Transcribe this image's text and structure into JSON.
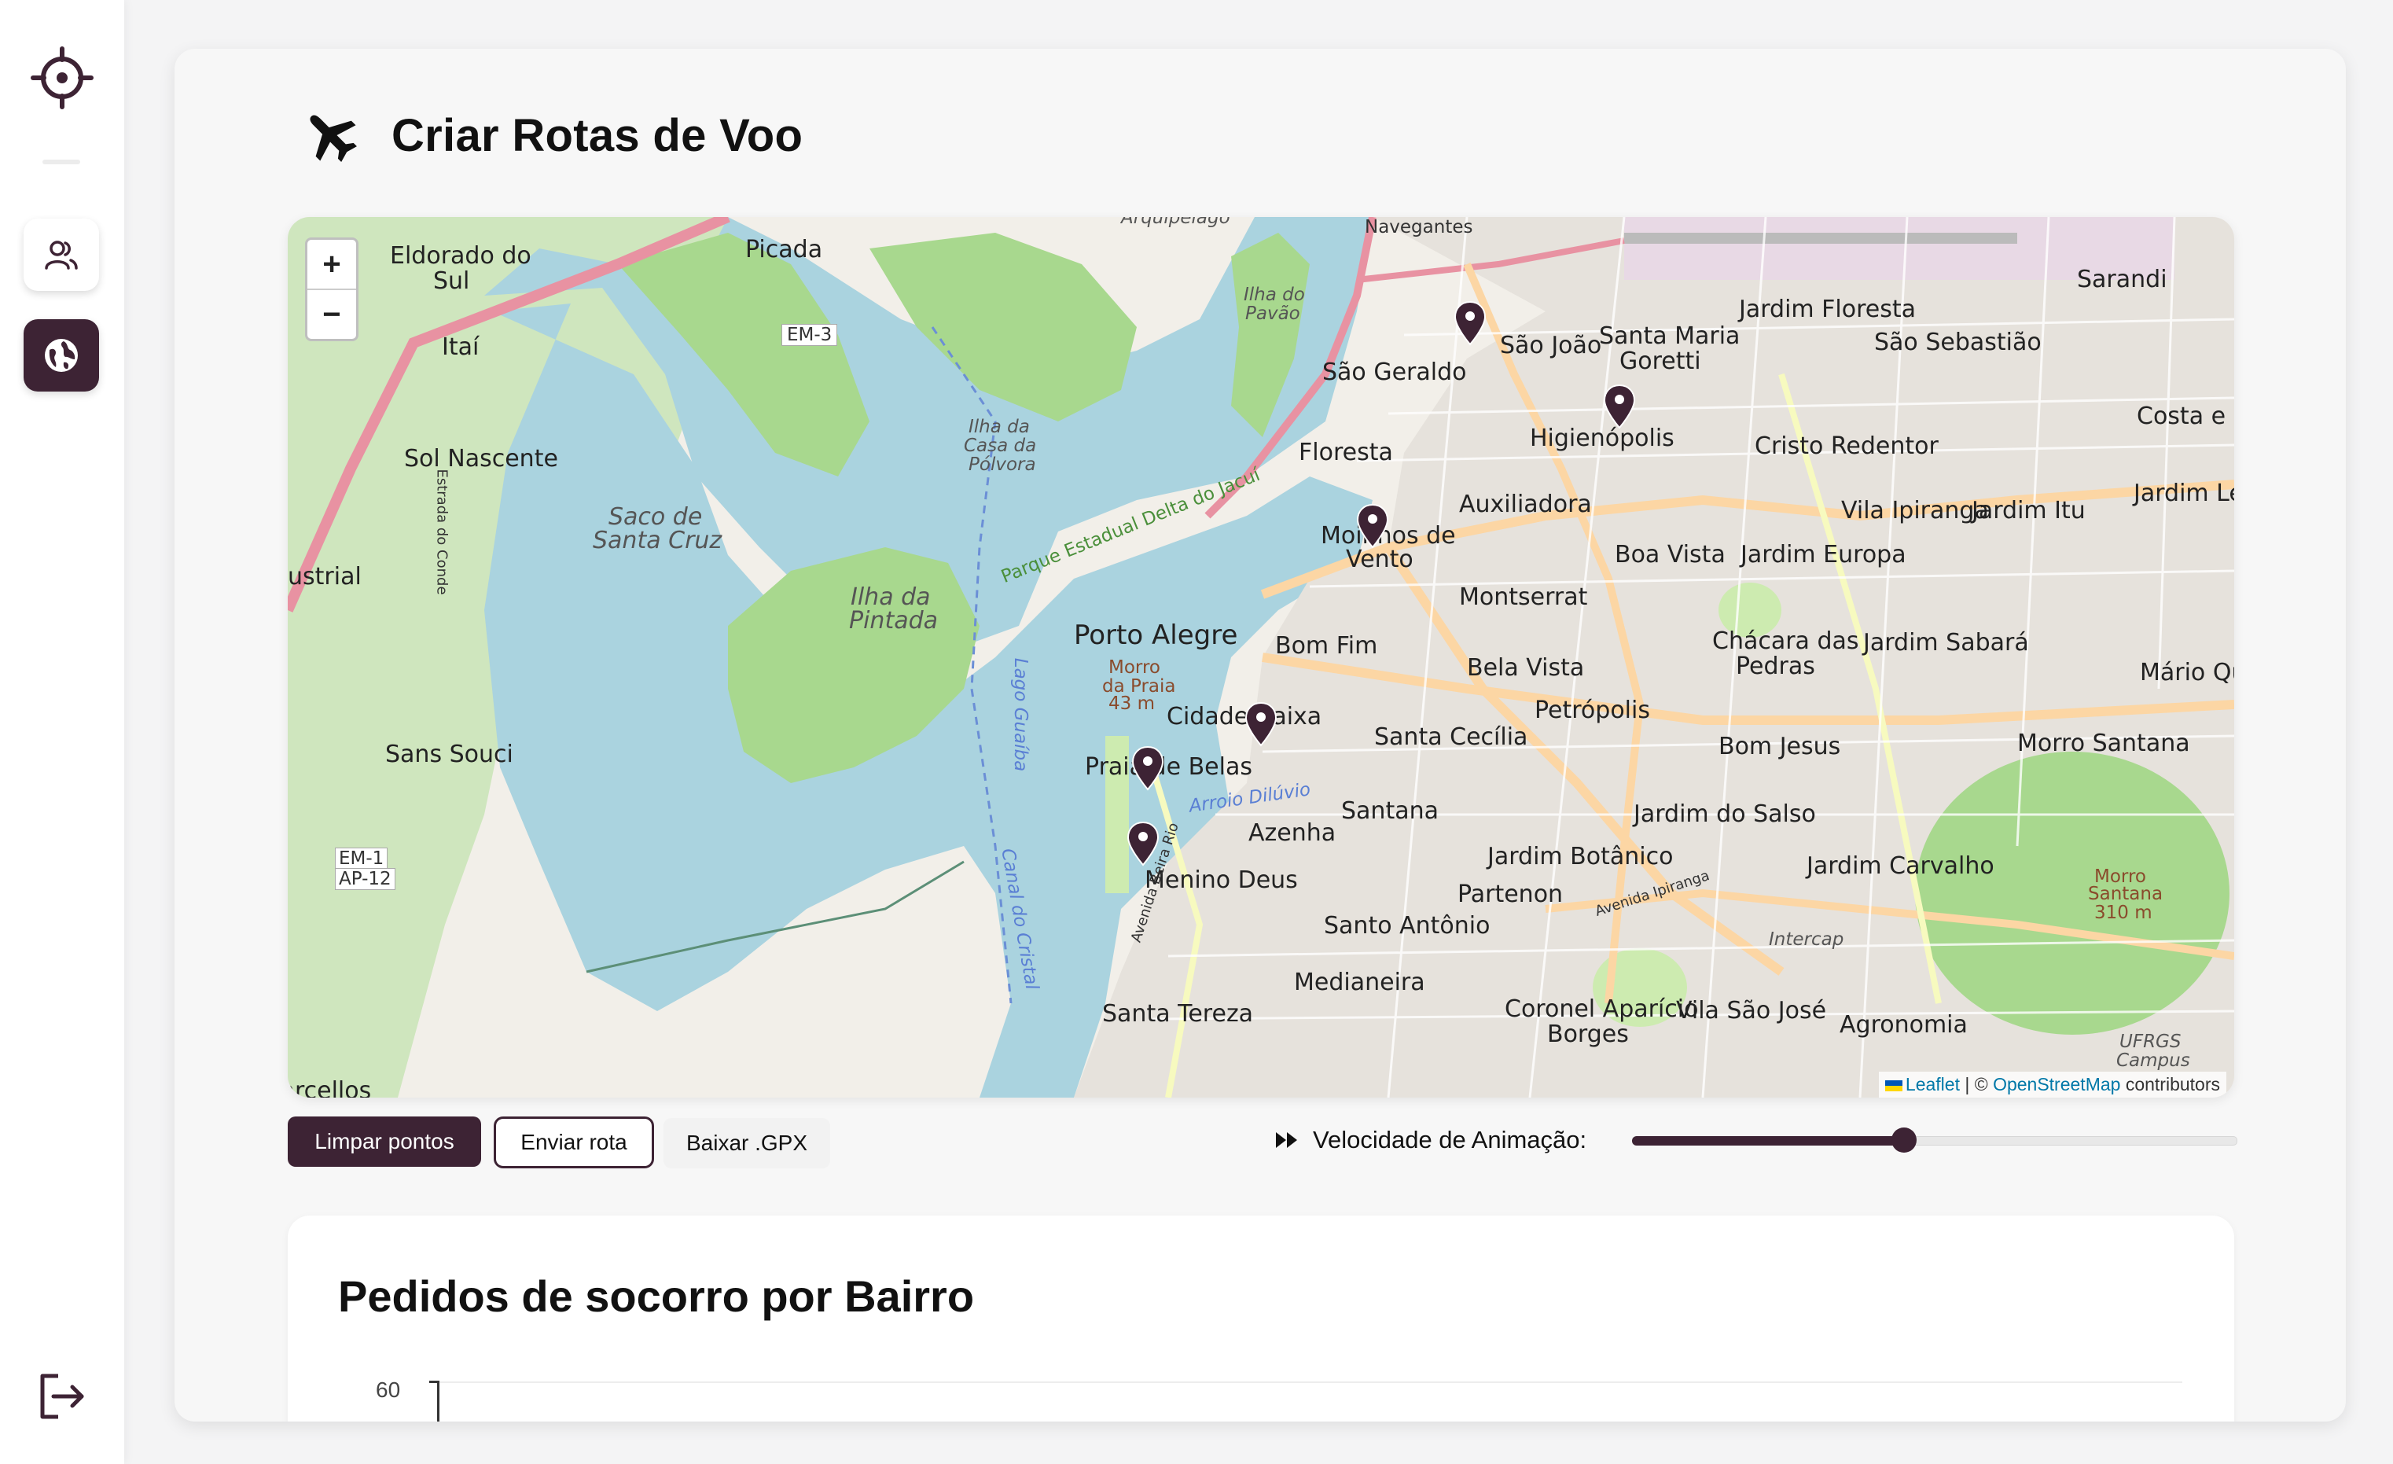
{
  "sidebar": {
    "logo_icon": "crosshair-icon",
    "items": [
      {
        "icon": "users-icon",
        "active": false
      },
      {
        "icon": "globe-icon",
        "active": true
      }
    ],
    "logout_icon": "logout-icon"
  },
  "page": {
    "title_icon": "airplane-icon",
    "title": "Criar Rotas de Voo"
  },
  "map": {
    "zoom_in": "+",
    "zoom_out": "−",
    "attribution": {
      "leaflet": "Leaflet",
      "separator": " | © ",
      "osm": "OpenStreetMap",
      "suffix": " contributors"
    },
    "labels": {
      "navegantes": "Navegantes",
      "arquipelago": "Arquipélago",
      "eldorado": "Eldorado do",
      "eldorado2": "Sul",
      "picada": "Picada",
      "itai": "Itaí",
      "em3": "EM-3",
      "ilha_pavao": "Ilha do",
      "ilha_pavao2": "Pavão",
      "ilha_casa": "Ilha da",
      "ilha_casa2": "Casa da",
      "ilha_casa3": "Pólvora",
      "sol_nascente": "Sol Nascente",
      "saco": "Saco de",
      "saco2": "Santa Cruz",
      "parque": "Parque Estadual Delta do Jacuí",
      "ilha_pintada": "Ilha da",
      "ilha_pintada2": "Pintada",
      "porto_alegre": "Porto Alegre",
      "sao_joao": "São João",
      "santa_maria": "Santa Maria",
      "goretti": "Goretti",
      "jardim_floresta": "Jardim Floresta",
      "sao_sebastiao": "São Sebastião",
      "sarandi": "Sarandi",
      "sao_geraldo": "São Geraldo",
      "higienopolis": "Higienópolis",
      "cristo_redentor": "Cristo Redentor",
      "costa_silva": "Costa e Silv",
      "floresta": "Floresta",
      "auxiliadora": "Auxiliadora",
      "vila_ipiranga": "Vila Ipiranga",
      "jardim_itu": "Jardim Itu",
      "jardim_leop": "Jardim Leop",
      "moinhos": "Moinhos de",
      "moinhos2": "Vento",
      "boa_vista": "Boa Vista",
      "jardim_europa": "Jardim Europa",
      "montserrat": "Montserrat",
      "bom_fim": "Bom Fim",
      "chacara": "Chácara das",
      "chacara2": "Pedras",
      "jardim_sabara": "Jardim Sabará",
      "mario_quin": "Mário Quin",
      "bela_vista": "Bela Vista",
      "cidade_baixa": "Cidade Baixa",
      "petropolis": "Petrópolis",
      "santa_cecilia": "Santa Cecília",
      "bom_jesus": "Bom Jesus",
      "morro_santana": "Morro Santana",
      "praia_belas": "Praia de Belas",
      "arroio": "Arroio Dilúvio",
      "santana": "Santana",
      "azenha": "Azenha",
      "jardim_salso": "Jardim do Salso",
      "jardim_botanico": "Jardim Botânico",
      "jardim_carvalho": "Jardim Carvalho",
      "menino_deus": "Menino Deus",
      "partenon": "Partenon",
      "santo_antonio": "Santo Antônio",
      "medianeira": "Medianeira",
      "santa_tereza": "Santa Tereza",
      "coronel": "Coronel Aparício",
      "coronel2": "Borges",
      "vila_sao_jose": "Vila São José",
      "agronomia": "Agronomia",
      "sans_souci": "Sans Souci",
      "em1": "EM-1",
      "ap12": "AP-12",
      "barcellos": "Barcellos",
      "ustrial": "ustrial",
      "lago_guaiba": "Lago Guaíba",
      "canal": "Canal do Cristal",
      "morro_praia": "Morro",
      "morro_praia2": "da Praia",
      "morro_praia3": "43 m",
      "ufrgs": "UFRGS",
      "campus": "Campus",
      "morro_santana_pk": "Morro",
      "morro_santana_pk2": "Santana",
      "morro_santana_pk3": "310 m",
      "intercap": "Intercap",
      "av_beira_rio": "Avenida Beira Rio",
      "av_ipiranga": "Avenida Ipiranga",
      "estrada_conde": "Estrada do Conde"
    }
  },
  "controls": {
    "clear_label": "Limpar pontos",
    "send_label": "Enviar rota",
    "gpx_label": "Baixar .GPX",
    "speed_icon": "fast-forward-icon",
    "speed_label": "Velocidade de Animação:",
    "speed_value": 0.45
  },
  "chart": {
    "title": "Pedidos de socorro por Bairro",
    "y_top_tick": "60"
  }
}
